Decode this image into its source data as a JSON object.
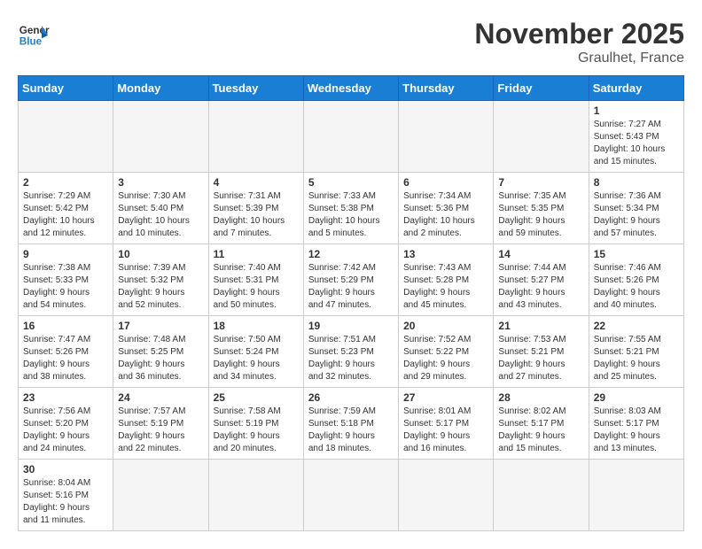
{
  "header": {
    "logo_general": "General",
    "logo_blue": "Blue",
    "month": "November 2025",
    "location": "Graulhet, France"
  },
  "days_of_week": [
    "Sunday",
    "Monday",
    "Tuesday",
    "Wednesday",
    "Thursday",
    "Friday",
    "Saturday"
  ],
  "weeks": [
    [
      {
        "day": "",
        "info": ""
      },
      {
        "day": "",
        "info": ""
      },
      {
        "day": "",
        "info": ""
      },
      {
        "day": "",
        "info": ""
      },
      {
        "day": "",
        "info": ""
      },
      {
        "day": "",
        "info": ""
      },
      {
        "day": "1",
        "info": "Sunrise: 7:27 AM\nSunset: 5:43 PM\nDaylight: 10 hours\nand 15 minutes."
      }
    ],
    [
      {
        "day": "2",
        "info": "Sunrise: 7:29 AM\nSunset: 5:42 PM\nDaylight: 10 hours\nand 12 minutes."
      },
      {
        "day": "3",
        "info": "Sunrise: 7:30 AM\nSunset: 5:40 PM\nDaylight: 10 hours\nand 10 minutes."
      },
      {
        "day": "4",
        "info": "Sunrise: 7:31 AM\nSunset: 5:39 PM\nDaylight: 10 hours\nand 7 minutes."
      },
      {
        "day": "5",
        "info": "Sunrise: 7:33 AM\nSunset: 5:38 PM\nDaylight: 10 hours\nand 5 minutes."
      },
      {
        "day": "6",
        "info": "Sunrise: 7:34 AM\nSunset: 5:36 PM\nDaylight: 10 hours\nand 2 minutes."
      },
      {
        "day": "7",
        "info": "Sunrise: 7:35 AM\nSunset: 5:35 PM\nDaylight: 9 hours\nand 59 minutes."
      },
      {
        "day": "8",
        "info": "Sunrise: 7:36 AM\nSunset: 5:34 PM\nDaylight: 9 hours\nand 57 minutes."
      }
    ],
    [
      {
        "day": "9",
        "info": "Sunrise: 7:38 AM\nSunset: 5:33 PM\nDaylight: 9 hours\nand 54 minutes."
      },
      {
        "day": "10",
        "info": "Sunrise: 7:39 AM\nSunset: 5:32 PM\nDaylight: 9 hours\nand 52 minutes."
      },
      {
        "day": "11",
        "info": "Sunrise: 7:40 AM\nSunset: 5:31 PM\nDaylight: 9 hours\nand 50 minutes."
      },
      {
        "day": "12",
        "info": "Sunrise: 7:42 AM\nSunset: 5:29 PM\nDaylight: 9 hours\nand 47 minutes."
      },
      {
        "day": "13",
        "info": "Sunrise: 7:43 AM\nSunset: 5:28 PM\nDaylight: 9 hours\nand 45 minutes."
      },
      {
        "day": "14",
        "info": "Sunrise: 7:44 AM\nSunset: 5:27 PM\nDaylight: 9 hours\nand 43 minutes."
      },
      {
        "day": "15",
        "info": "Sunrise: 7:46 AM\nSunset: 5:26 PM\nDaylight: 9 hours\nand 40 minutes."
      }
    ],
    [
      {
        "day": "16",
        "info": "Sunrise: 7:47 AM\nSunset: 5:26 PM\nDaylight: 9 hours\nand 38 minutes."
      },
      {
        "day": "17",
        "info": "Sunrise: 7:48 AM\nSunset: 5:25 PM\nDaylight: 9 hours\nand 36 minutes."
      },
      {
        "day": "18",
        "info": "Sunrise: 7:50 AM\nSunset: 5:24 PM\nDaylight: 9 hours\nand 34 minutes."
      },
      {
        "day": "19",
        "info": "Sunrise: 7:51 AM\nSunset: 5:23 PM\nDaylight: 9 hours\nand 32 minutes."
      },
      {
        "day": "20",
        "info": "Sunrise: 7:52 AM\nSunset: 5:22 PM\nDaylight: 9 hours\nand 29 minutes."
      },
      {
        "day": "21",
        "info": "Sunrise: 7:53 AM\nSunset: 5:21 PM\nDaylight: 9 hours\nand 27 minutes."
      },
      {
        "day": "22",
        "info": "Sunrise: 7:55 AM\nSunset: 5:21 PM\nDaylight: 9 hours\nand 25 minutes."
      }
    ],
    [
      {
        "day": "23",
        "info": "Sunrise: 7:56 AM\nSunset: 5:20 PM\nDaylight: 9 hours\nand 24 minutes."
      },
      {
        "day": "24",
        "info": "Sunrise: 7:57 AM\nSunset: 5:19 PM\nDaylight: 9 hours\nand 22 minutes."
      },
      {
        "day": "25",
        "info": "Sunrise: 7:58 AM\nSunset: 5:19 PM\nDaylight: 9 hours\nand 20 minutes."
      },
      {
        "day": "26",
        "info": "Sunrise: 7:59 AM\nSunset: 5:18 PM\nDaylight: 9 hours\nand 18 minutes."
      },
      {
        "day": "27",
        "info": "Sunrise: 8:01 AM\nSunset: 5:17 PM\nDaylight: 9 hours\nand 16 minutes."
      },
      {
        "day": "28",
        "info": "Sunrise: 8:02 AM\nSunset: 5:17 PM\nDaylight: 9 hours\nand 15 minutes."
      },
      {
        "day": "29",
        "info": "Sunrise: 8:03 AM\nSunset: 5:17 PM\nDaylight: 9 hours\nand 13 minutes."
      }
    ],
    [
      {
        "day": "30",
        "info": "Sunrise: 8:04 AM\nSunset: 5:16 PM\nDaylight: 9 hours\nand 11 minutes."
      },
      {
        "day": "",
        "info": ""
      },
      {
        "day": "",
        "info": ""
      },
      {
        "day": "",
        "info": ""
      },
      {
        "day": "",
        "info": ""
      },
      {
        "day": "",
        "info": ""
      },
      {
        "day": "",
        "info": ""
      }
    ]
  ]
}
